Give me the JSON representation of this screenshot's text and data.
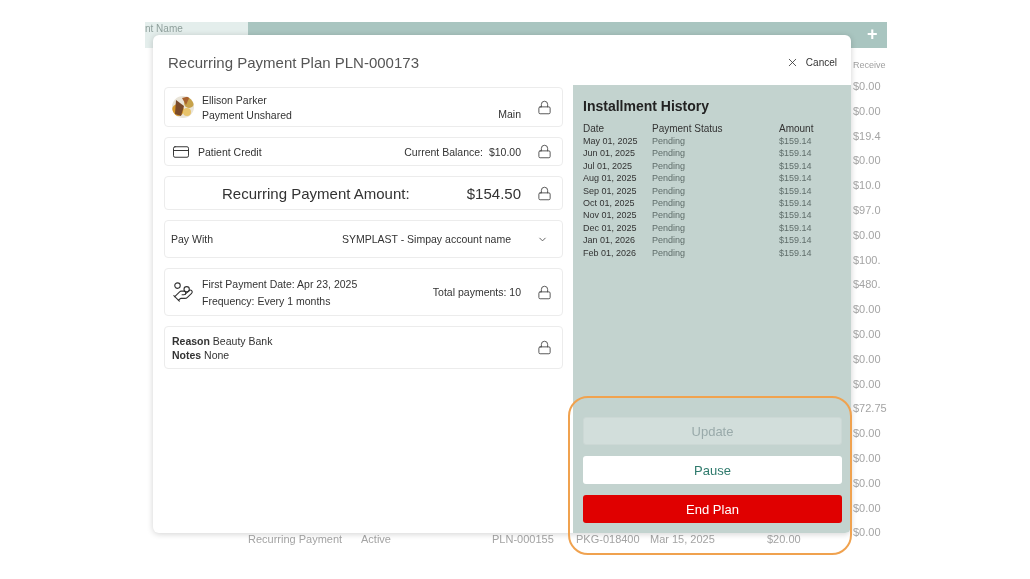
{
  "background_table": {
    "header": {
      "column_1": "nt Name",
      "add_button": "+"
    },
    "column_header": "Receive",
    "amounts": [
      "$0.00",
      "$0.00",
      "$19.4",
      "$0.00",
      "$10.0",
      "$97.0",
      "$0.00",
      "$100.",
      "$480.",
      "$0.00",
      "$0.00",
      "$0.00",
      "$0.00",
      "$72.75",
      "$0.00",
      "$0.00",
      "$0.00",
      "$0.00",
      "$0.00"
    ],
    "bottom_row": [
      "Recurring Payment",
      "Active",
      "PLN-000155",
      "PKG-018400",
      "Mar 15, 2025",
      "$20.00"
    ]
  },
  "dialog": {
    "title": "Recurring Payment Plan PLN-000173",
    "cancel": "Cancel",
    "cards": [
      {
        "kind": "patient",
        "name": "Ellison Parker",
        "sharing": "Payment Unshared",
        "tag": "Main",
        "locked": true
      },
      {
        "kind": "credit",
        "label": "Patient Credit",
        "balance": "Current Balance:  $10.00",
        "locked": true
      },
      {
        "kind": "amount",
        "label": "Recurring Payment Amount:",
        "value": "$154.50",
        "locked": true
      },
      {
        "kind": "select",
        "label": "Pay With",
        "value": "SYMPLAST - Simpay account name"
      },
      {
        "kind": "schedule",
        "first_date": "First Payment Date: Apr 23, 2025",
        "frequency": "Frequency: Every 1 months",
        "total": "Total payments: 10",
        "locked": true
      },
      {
        "kind": "notes",
        "reason": "**Reason** Beauty Bank",
        "notes": "**Notes** None",
        "locked": true
      }
    ],
    "history": {
      "title": "Installment History",
      "columns": [
        "Date",
        "Payment Status",
        "Amount"
      ],
      "rows": [
        [
          "May 01, 2025",
          "Pending",
          "$159.14"
        ],
        [
          "Jun 01, 2025",
          "Pending",
          "$159.14"
        ],
        [
          "Jul 01, 2025",
          "Pending",
          "$159.14"
        ],
        [
          "Aug 01, 2025",
          "Pending",
          "$159.14"
        ],
        [
          "Sep 01, 2025",
          "Pending",
          "$159.14"
        ],
        [
          "Oct 01, 2025",
          "Pending",
          "$159.14"
        ],
        [
          "Nov 01, 2025",
          "Pending",
          "$159.14"
        ],
        [
          "Dec 01, 2025",
          "Pending",
          "$159.14"
        ],
        [
          "Jan 01, 2026",
          "Pending",
          "$159.14"
        ],
        [
          "Feb 01, 2026",
          "Pending",
          "$159.14"
        ]
      ]
    },
    "actions": [
      {
        "kind": "secondary",
        "label": "Update",
        "disabled": true
      },
      {
        "kind": "secondary",
        "label": "Pause",
        "disabled": false
      },
      {
        "kind": "danger",
        "label": "End Plan",
        "disabled": false
      }
    ]
  },
  "annotation": {
    "kind": "ring"
  }
}
